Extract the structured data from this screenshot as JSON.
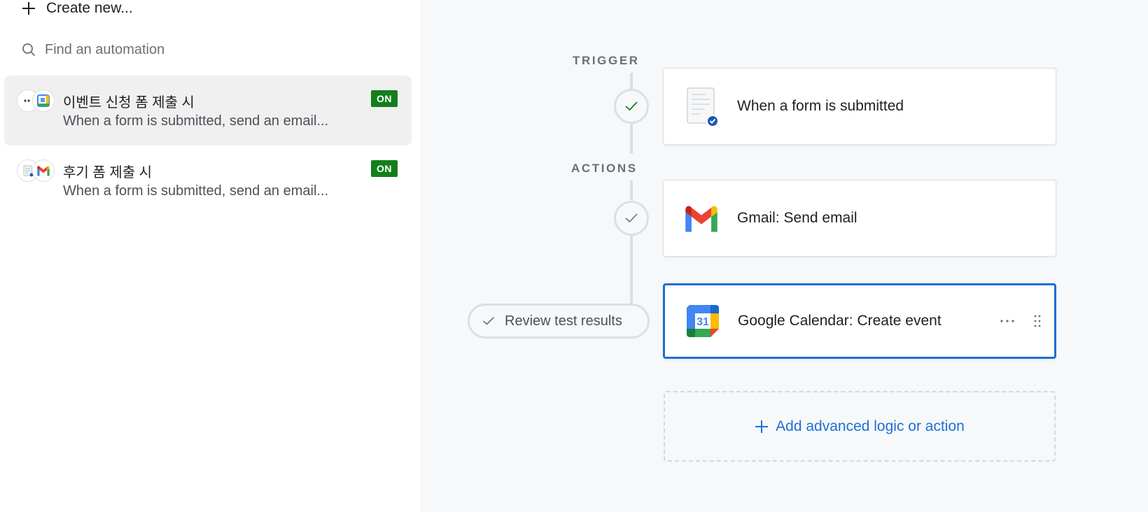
{
  "sidebar": {
    "create_new_label": "Create new...",
    "search_placeholder": "Find an automation",
    "automations": [
      {
        "title": "이벤트 신청 폼 제출 시",
        "description": "When a form is submitted, send an email...",
        "status": "ON",
        "icons": [
          "form-icon",
          "google-calendar-icon"
        ],
        "selected": true
      },
      {
        "title": "후기 폼 제출 시",
        "description": "When a form is submitted, send an email...",
        "status": "ON",
        "icons": [
          "form-icon",
          "gmail-icon"
        ],
        "selected": false
      }
    ]
  },
  "flow": {
    "trigger_label": "TRIGGER",
    "actions_label": "ACTIONS",
    "trigger": {
      "title": "When a form is submitted",
      "icon": "form-check-icon"
    },
    "actions": [
      {
        "title": "Gmail: Send email",
        "icon": "gmail-icon"
      },
      {
        "title": "Google Calendar: Create event",
        "icon": "google-calendar-icon",
        "calendar_day": "31"
      }
    ],
    "review_label": "Review test results",
    "add_label": "Add advanced logic or action"
  },
  "colors": {
    "accent": "#1f6fd6",
    "on_badge": "#137f1b",
    "check_green": "#137f1b",
    "connector": "#dcdfe3"
  }
}
